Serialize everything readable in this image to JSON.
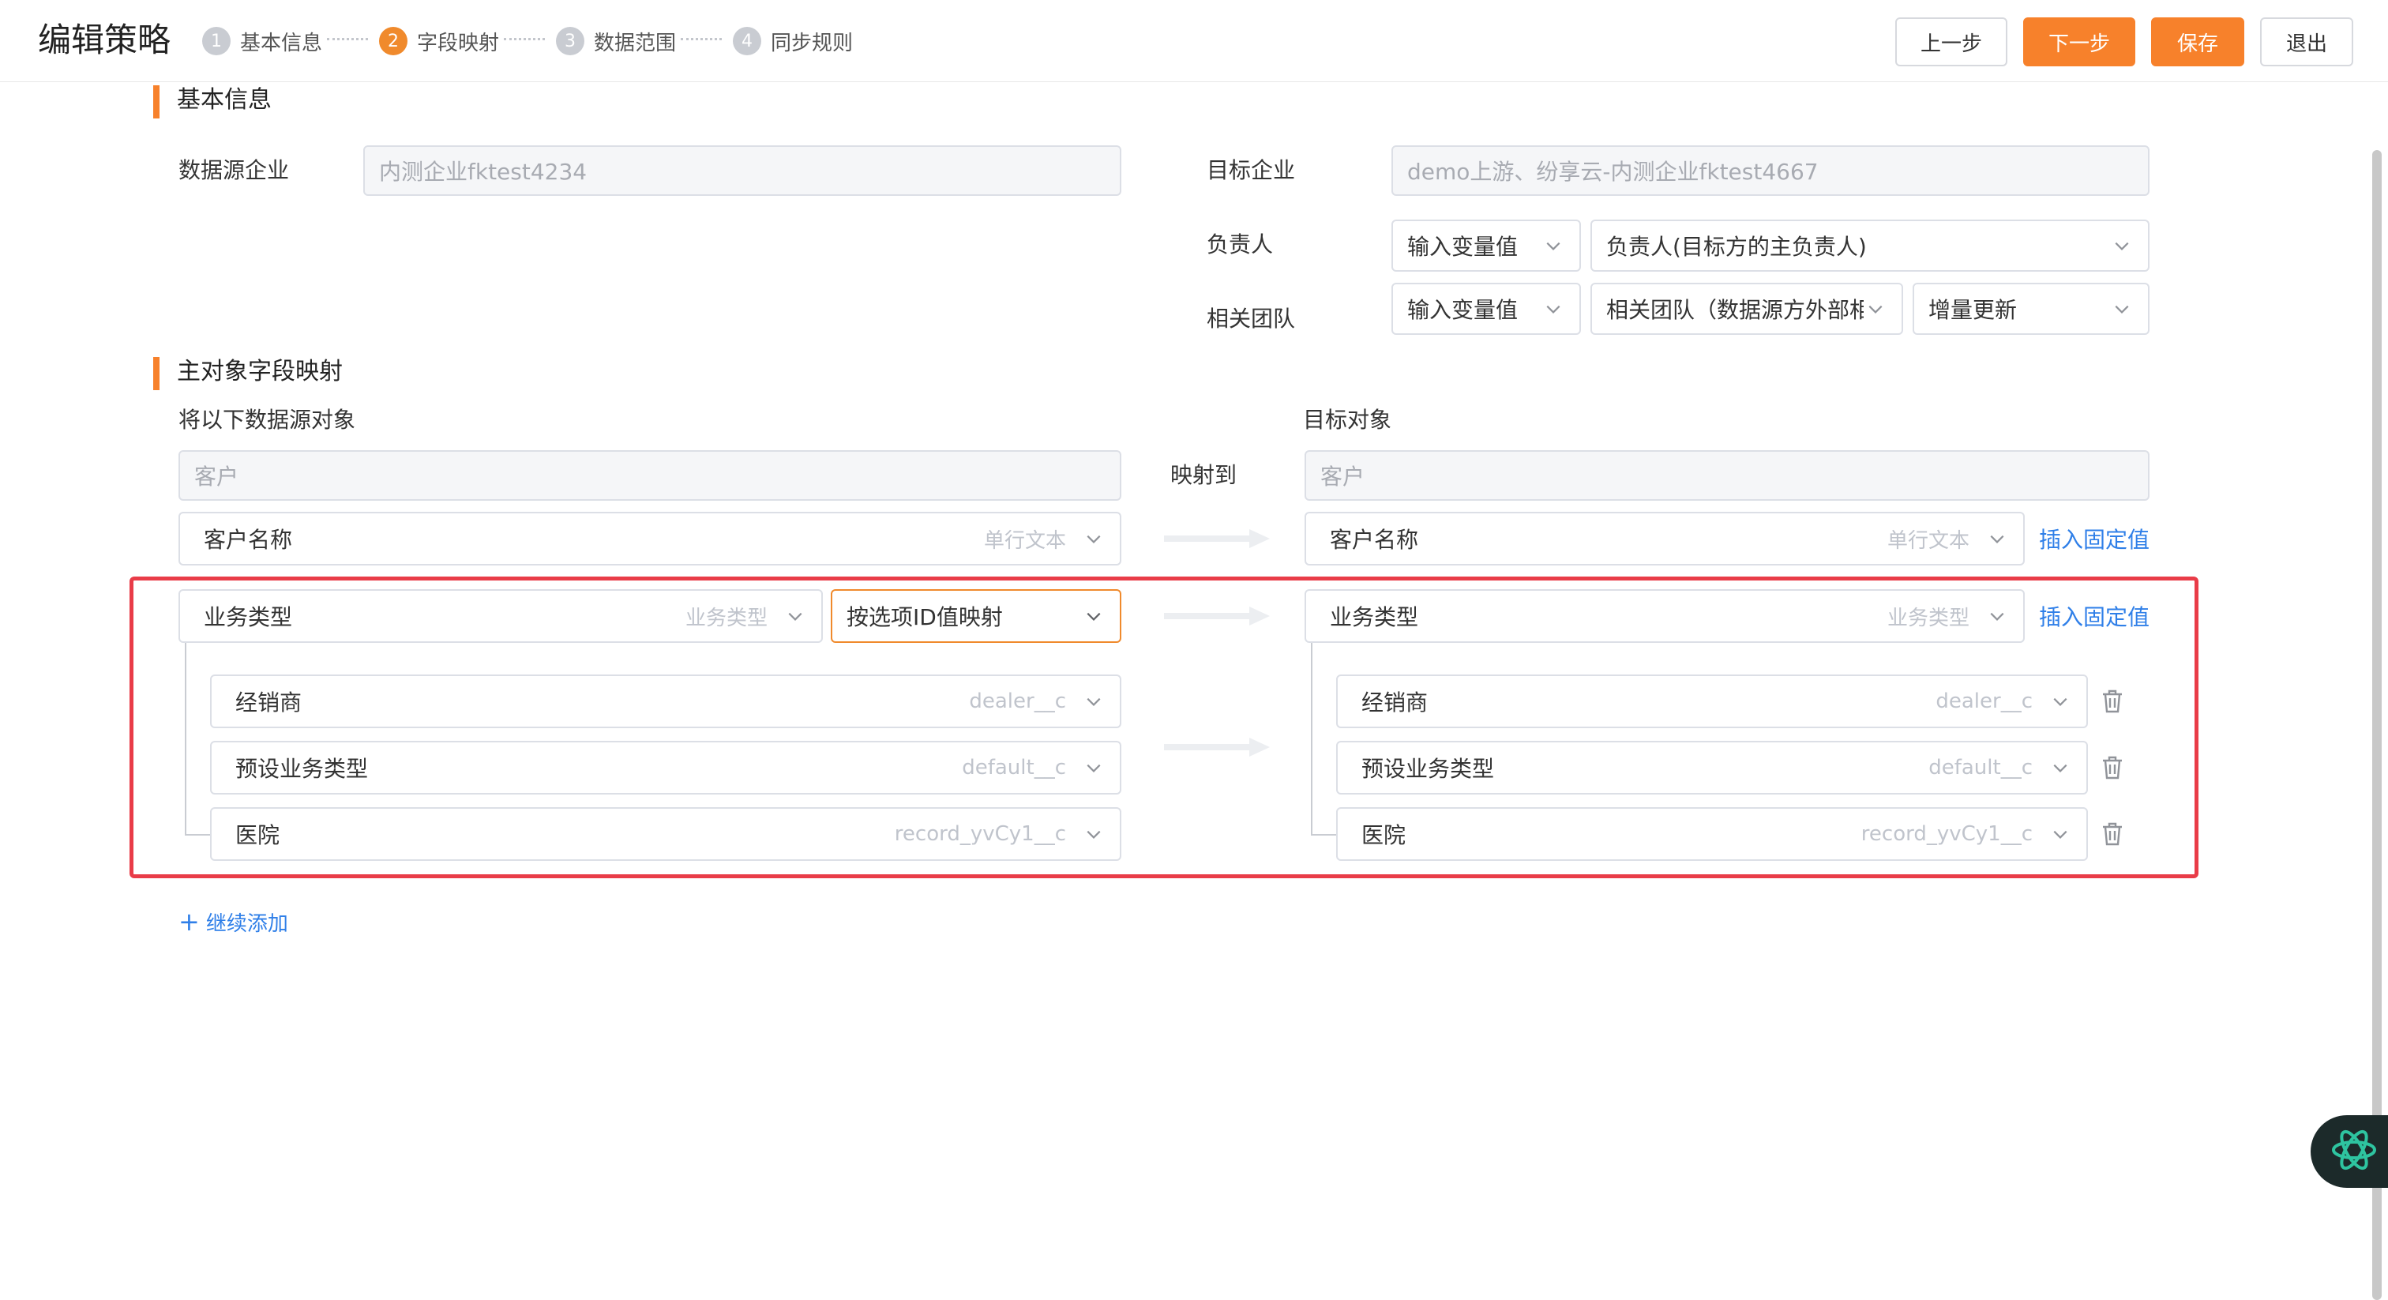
{
  "header": {
    "title": "编辑策略",
    "steps": [
      {
        "num": "1",
        "label": "基本信息"
      },
      {
        "num": "2",
        "label": "字段映射"
      },
      {
        "num": "3",
        "label": "数据范围"
      },
      {
        "num": "4",
        "label": "同步规则"
      }
    ],
    "active_step": 2,
    "buttons": {
      "prev": "上一步",
      "next": "下一步",
      "save": "保存",
      "exit": "退出"
    }
  },
  "basic_info": {
    "title": "基本信息",
    "source_company_label": "数据源企业",
    "source_company_value": "内测企业fktest4234",
    "target_company_label": "目标企业",
    "target_company_value": "demo上游、纷享云-内测企业fktest4667",
    "owner_label": "负责人",
    "owner_mode": "输入变量值",
    "owner_value": "负责人(目标方的主负责人)",
    "team_label": "相关团队",
    "team_mode": "输入变量值",
    "team_value": "相关团队（数据源方外部相",
    "team_update": "增量更新"
  },
  "mapping": {
    "title": "主对象字段映射",
    "source_header": "将以下数据源对象",
    "target_header": "目标对象",
    "map_to_label": "映射到",
    "source_object": "客户",
    "target_object": "客户",
    "insert_fixed_label": "插入固定值",
    "rows": {
      "name": {
        "src": "客户名称",
        "src_type": "单行文本",
        "tgt": "客户名称",
        "tgt_type": "单行文本"
      },
      "biz": {
        "src": "业务类型",
        "src_type": "业务类型",
        "mode": "按选项ID值映射",
        "tgt": "业务类型",
        "tgt_type": "业务类型"
      },
      "options": [
        {
          "src": "经销商",
          "src_type": "dealer__c",
          "tgt": "经销商",
          "tgt_type": "dealer__c"
        },
        {
          "src": "预设业务类型",
          "src_type": "default__c",
          "tgt": "预设业务类型",
          "tgt_type": "default__c"
        },
        {
          "src": "医院",
          "src_type": "record_yvCy1__c",
          "tgt": "医院",
          "tgt_type": "record_yvCy1__c"
        }
      ]
    },
    "add_more_label": "继续添加",
    "add_more_icon": "+"
  },
  "colors": {
    "accent": "#f7812b",
    "link": "#2f7fe8",
    "highlight": "#e93c48"
  }
}
